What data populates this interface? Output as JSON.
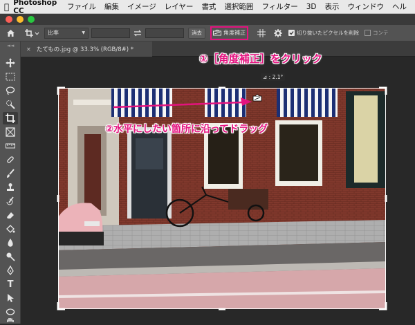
{
  "menubar": {
    "app_name": "Photoshop CC",
    "items": [
      "ファイル",
      "編集",
      "イメージ",
      "レイヤー",
      "書式",
      "選択範囲",
      "フィルター",
      "3D",
      "表示",
      "ウィンドウ",
      "ヘル"
    ]
  },
  "options": {
    "ratio_label": "比率",
    "clear_label": "消去",
    "straighten_label": "角度補正",
    "delete_pixels_label": "切り抜いたピクセルを削除",
    "content_label": "コンテ",
    "delete_pixels_checked": true
  },
  "document": {
    "tab_title": "たてもの.jpg @ 33.3% (RGB/8#) *"
  },
  "canvas": {
    "angle_readout": "⊿ : 2.1°"
  },
  "annotations": {
    "step1": "①［角度補正］をクリック",
    "step2": "②水平にしたい箇所に沿ってドラッグ"
  },
  "colors": {
    "accent": "#e4127f",
    "ui_dark": "#535353",
    "canvas_bg": "#282828"
  }
}
